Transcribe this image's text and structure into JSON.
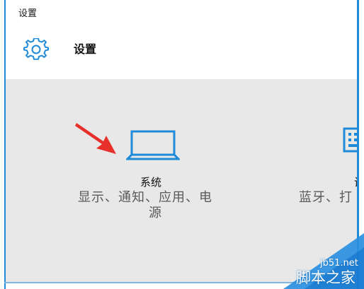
{
  "window": {
    "title": "设置"
  },
  "header": {
    "page_title": "设置",
    "icon": "gear-icon"
  },
  "tiles": [
    {
      "label": "系统",
      "description_line1": "显示、通知、应用、电",
      "description_line2": "源",
      "icon": "laptop-icon"
    },
    {
      "label": "设",
      "description_line1": "蓝牙、打",
      "description_line2": "",
      "icon": "device-icon"
    }
  ],
  "annotation": {
    "arrow_color": "#e8302a"
  },
  "watermark": {
    "site": "jb51.net",
    "name": "脚本之家"
  },
  "colors": {
    "accent": "#1f8ad8",
    "content_bg": "#e8e8e8"
  }
}
